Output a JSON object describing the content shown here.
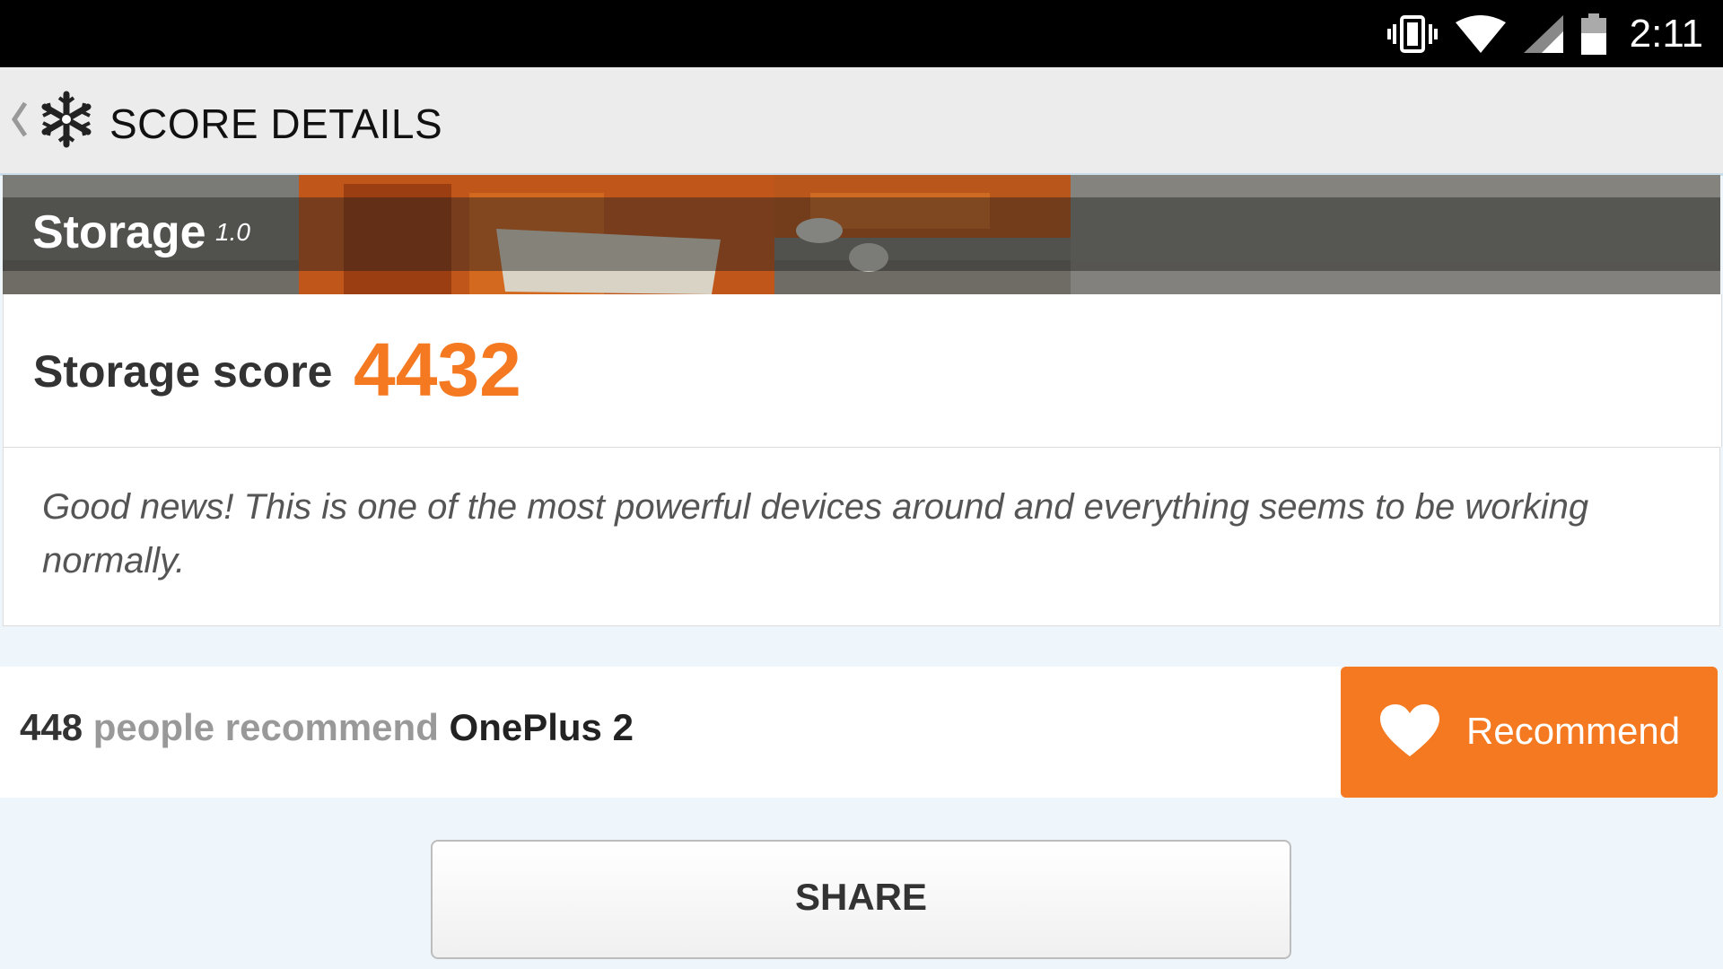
{
  "status_bar": {
    "time": "2:11",
    "icons": [
      "vibrate-icon",
      "wifi-icon",
      "signal-icon",
      "battery-icon"
    ]
  },
  "app_bar": {
    "title": "SCORE DETAILS",
    "icons": [
      "back-chevron-icon",
      "snowflake-logo-icon"
    ]
  },
  "banner": {
    "title": "Storage",
    "version": "1.0"
  },
  "score": {
    "label": "Storage score",
    "value": "4432",
    "accent_color": "#f47920"
  },
  "message": {
    "text": "Good news! This is one of the most powerful devices around and everything seems to be working normally."
  },
  "recommend": {
    "count": "448",
    "middle_text": "people recommend",
    "device": "OnePlus 2",
    "button_label": "Recommend",
    "button_icon": "heart-icon"
  },
  "share": {
    "label": "SHARE"
  }
}
